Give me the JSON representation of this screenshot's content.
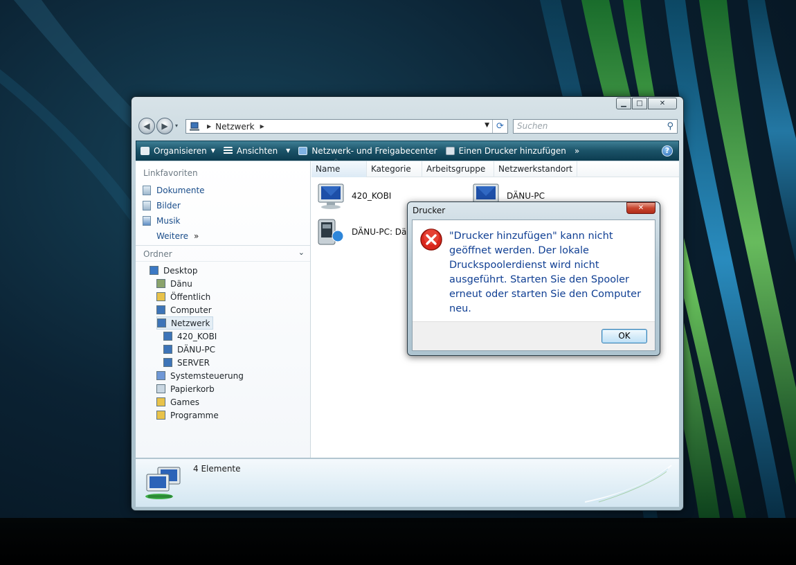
{
  "explorer": {
    "address": {
      "crumb": "Netzwerk"
    },
    "search": {
      "placeholder": "Suchen"
    },
    "toolbar": {
      "organize": "Organisieren",
      "views": "Ansichten",
      "network_center": "Netzwerk- und Freigabecenter",
      "add_printer": "Einen Drucker hinzufügen",
      "more": "»"
    },
    "nav": {
      "favorites_header": "Linkfavoriten",
      "favorites": [
        "Dokumente",
        "Bilder",
        "Musik"
      ],
      "more": "Weitere",
      "folders_header": "Ordner",
      "tree": [
        {
          "label": "Desktop",
          "icon": "desktop-icon",
          "color": "#3b78c4"
        },
        {
          "label": "Dänu",
          "icon": "user-folder-icon",
          "color": "#8aa36c"
        },
        {
          "label": "Öffentlich",
          "icon": "folder-icon",
          "color": "#e8c24a"
        },
        {
          "label": "Computer",
          "icon": "computer-icon",
          "color": "#3d74b8"
        },
        {
          "label": "Netzwerk",
          "icon": "network-icon",
          "color": "#3d74b8"
        },
        {
          "label": "420_KOBI",
          "icon": "computer-icon",
          "color": "#3d74b8"
        },
        {
          "label": "DÄNU-PC",
          "icon": "computer-icon",
          "color": "#3d74b8"
        },
        {
          "label": "SERVER",
          "icon": "computer-icon",
          "color": "#3d74b8"
        },
        {
          "label": "Systemsteuerung",
          "icon": "control-panel-icon",
          "color": "#6f97d6"
        },
        {
          "label": "Papierkorb",
          "icon": "recycle-bin-icon",
          "color": "#c9d7e2"
        },
        {
          "label": "Games",
          "icon": "folder-icon",
          "color": "#e8c24a"
        },
        {
          "label": "Programme",
          "icon": "folder-icon",
          "color": "#e8c24a"
        }
      ]
    },
    "columns": [
      "Name",
      "Kategorie",
      "Arbeitsgruppe",
      "Netzwerkstandort"
    ],
    "items": [
      "420_KOBI",
      "DÄNU-PC",
      "DÄNU-PC: Dän"
    ],
    "status": {
      "count": "4 Elemente"
    }
  },
  "dialog": {
    "title": "Drucker",
    "message": "\"Drucker hinzufügen\" kann nicht geöffnet werden. Der lokale Druckspoolerdienst wird nicht ausgeführt. Starten Sie den Spooler erneut oder starten Sie den Computer neu.",
    "ok": "OK"
  },
  "colors": {
    "toolbar": "#1b5368",
    "link": "#1a4d8a",
    "error": "#d9261c",
    "message": "#103f93"
  }
}
